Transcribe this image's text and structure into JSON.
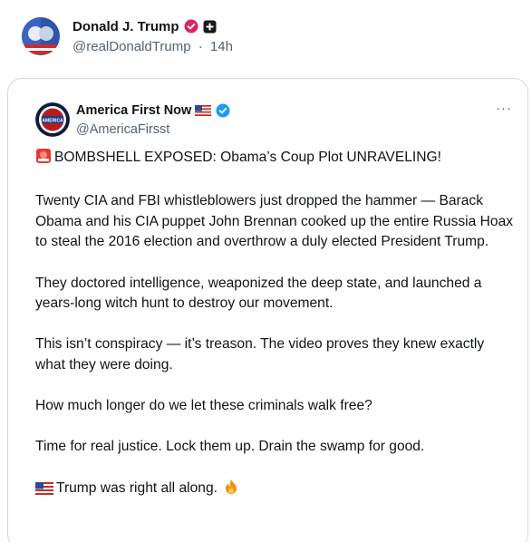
{
  "outer_post": {
    "display_name": "Donald J. Trump",
    "handle": "@realDonaldTrump",
    "separator": "·",
    "time": "14h"
  },
  "quoted_post": {
    "display_name": "America First Now",
    "handle": "@AmericaFirsst",
    "more_label": "···",
    "paragraphs": [
      "BOMBSHELL EXPOSED: Obama’s Coup Plot UNRAVELING!",
      "Twenty CIA and FBI whistleblowers just dropped the hammer — Barack Obama and his CIA puppet John Brennan cooked up the entire Russia Hoax to steal the 2016 election and overthrow a duly elected President Trump.",
      "They doctored intelligence, weaponized the deep state, and launched a years-long witch hunt to destroy our movement.",
      "This isn’t conspiracy — it’s treason. The video proves they knew exactly what they were doing.",
      "How much longer do we let these criminals walk free?",
      "Time for real justice. Lock them up. Drain the swamp for good.",
      "Trump was right all along."
    ]
  },
  "icons": {
    "outer_badge": "verified-pink-badge-icon",
    "outer_affiliate": "government-affiliate-icon",
    "inner_flag": "us-flag-icon",
    "inner_badge": "verified-blue-badge-icon",
    "siren": "police-light-icon",
    "us_flag_inline": "us-flag-icon",
    "fire": "fire-icon"
  },
  "colors": {
    "text": "#0f1419",
    "secondary_text": "#536471",
    "border": "#cfd9de",
    "verified_pink": "#e0245e",
    "verified_blue": "#1d9bf0"
  }
}
